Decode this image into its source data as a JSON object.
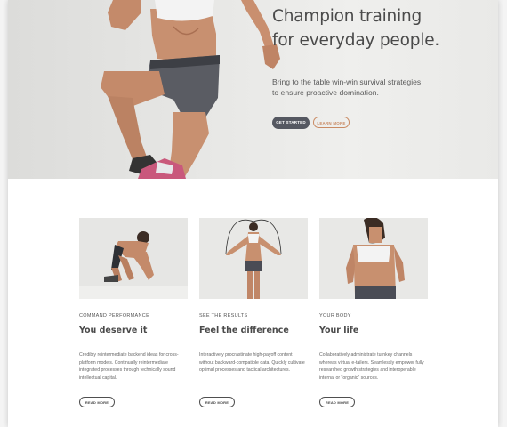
{
  "hero": {
    "title_line1": "Champion training",
    "title_line2": "for everyday people.",
    "subtitle_line1": "Bring to the table win-win survival strategies",
    "subtitle_line2": "to ensure proactive domination.",
    "primary_button": "GET STARTED",
    "secondary_button": "LEARN MORE"
  },
  "cards": [
    {
      "kicker": "COMMAND PERFORMANCE",
      "title": "You deserve it",
      "text": "Credibly reintermediate backend ideas for cross-platform models. Continually reintermediate integrated processes through technically sound intellectual capital.",
      "button": "READ MORE"
    },
    {
      "kicker": "SEE THE RESULTS",
      "title": "Feel the difference",
      "text": "Interactively procrastinate high-payoff content without backward-compatible data. Quickly cultivate optimal processes and tactical architectures.",
      "button": "READ MORE"
    },
    {
      "kicker": "YOUR BODY",
      "title": "Your life",
      "text": "Collaboratively administrate turnkey channels whereas virtual e-tailers. Seamlessly empower fully researched growth strategies and interoperable internal or \"organic\" sources.",
      "button": "READ MORE"
    }
  ]
}
